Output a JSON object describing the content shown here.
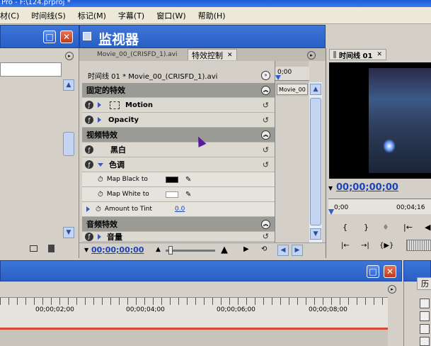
{
  "window": {
    "title": "Pro - F:\\124.prproj *"
  },
  "menu": [
    "材(C)",
    "时间线(S)",
    "标记(M)",
    "字幕(T)",
    "窗口(W)",
    "帮助(H)"
  ],
  "monitor_panel": {
    "title": "监视器"
  },
  "tabs": {
    "source": "Movie_00_(CRISFD_1).avi",
    "effects": "特效控制"
  },
  "effects": {
    "clip_header": "时间线 01 * Movie_00_(CRISFD_1).avi",
    "fixed_header": "固定的特效",
    "motion": "Motion",
    "opacity": "Opacity",
    "video_header": "视频特效",
    "black_white": "黑白",
    "tint": "色调",
    "map_black": "Map Black to",
    "map_white": "Map White to",
    "amount": "Amount to Tint",
    "amount_value": "0.0",
    "audio_header": "音频特效",
    "volume": "音量",
    "timecode": "00;00;00;00",
    "mini_time": "0;00",
    "clip_label": "Movie_00",
    "colors": {
      "black": "#000000",
      "white": "#ffffff"
    }
  },
  "program": {
    "tab": "时间线 01",
    "timecode": "00;00;00;00",
    "ruler_start": "0;00",
    "ruler_end": "00;04;16"
  },
  "timeline": {
    "ruler": [
      "00;00;02;00",
      "00;00;04;00",
      "00;00;06;00",
      "00;00;08;00"
    ]
  },
  "history": {
    "tab": "历"
  }
}
